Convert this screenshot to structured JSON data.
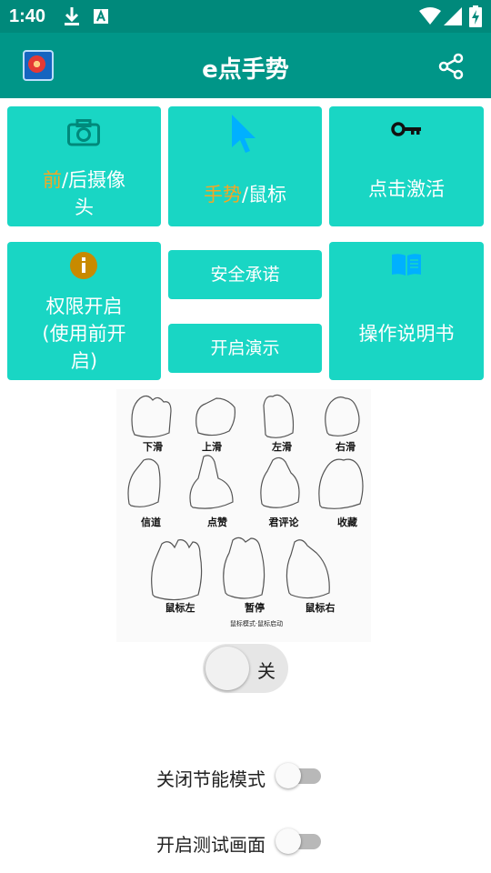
{
  "status_bar": {
    "time": "1:40",
    "icons": [
      "download-icon",
      "font-accessibility-icon",
      "wifi-icon",
      "signal-icon",
      "battery-charging-icon"
    ]
  },
  "app_bar": {
    "title": "e点手势",
    "logo_icon": "app-logo-icon",
    "share_icon": "share-icon"
  },
  "tiles": {
    "camera": {
      "accent": "前",
      "rest_line1": "/后摄像",
      "line2": "头",
      "icon": "camera-icon"
    },
    "gesture": {
      "accent": "手势",
      "rest": "/鼠标",
      "icon": "cursor-arrow-icon"
    },
    "activate": {
      "label": "点击激活",
      "icon": "key-icon"
    },
    "permission": {
      "line1": "权限开启",
      "line2": "(使用前开",
      "line3": "启)",
      "icon": "info-icon"
    },
    "safety": {
      "label": "安全承诺"
    },
    "demo": {
      "label": "开启演示"
    },
    "manual": {
      "label": "操作说明书",
      "icon": "book-icon"
    }
  },
  "gesture_image": {
    "labels": [
      "下滑",
      "上滑",
      "左滑",
      "右滑",
      "信道",
      "点赞",
      "君评论",
      "收藏",
      "鼠标左",
      "暂停",
      "鼠标右"
    ],
    "caption": "鼠标模式·鼠标启动"
  },
  "main_switch": {
    "label": "关",
    "on": false
  },
  "settings": [
    {
      "label": "关闭节能模式",
      "on": false
    },
    {
      "label": "开启测试画面",
      "on": false
    }
  ],
  "colors": {
    "status_bar": "#00897b",
    "app_bar": "#009688",
    "tile": "#19d6c4",
    "accent": "#f5a623",
    "icon_cyan": "#00b0ff",
    "icon_orange": "#c88a00"
  }
}
